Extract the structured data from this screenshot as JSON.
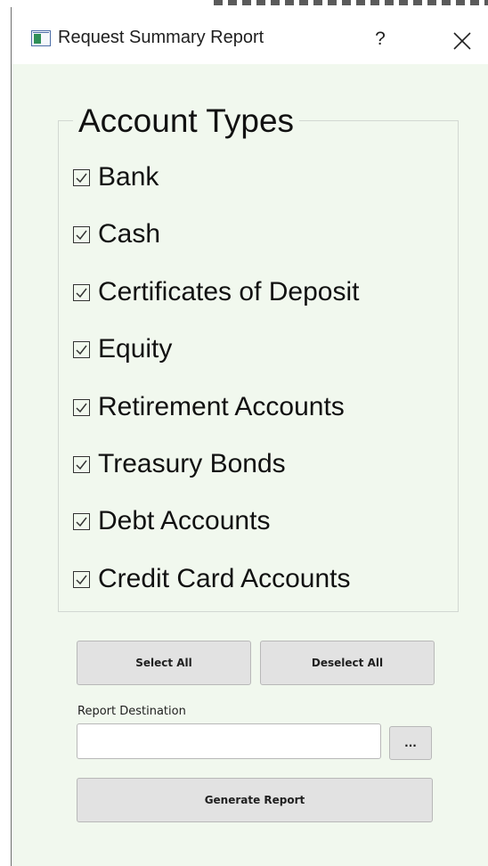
{
  "window": {
    "title": "Request Summary Report",
    "help_label": "?",
    "icon": "app-window-icon",
    "close_icon": "close-icon"
  },
  "account_types": {
    "title": "Account Types",
    "items": [
      {
        "label": "Bank",
        "checked": true
      },
      {
        "label": "Cash",
        "checked": true
      },
      {
        "label": "Certificates of Deposit",
        "checked": true
      },
      {
        "label": "Equity",
        "checked": true
      },
      {
        "label": "Retirement Accounts",
        "checked": true
      },
      {
        "label": "Treasury Bonds",
        "checked": true
      },
      {
        "label": "Debt Accounts",
        "checked": true
      },
      {
        "label": "Credit Card Accounts",
        "checked": true
      }
    ]
  },
  "actions": {
    "select_all": "Select All",
    "deselect_all": "Deselect All",
    "browse": "...",
    "generate": "Generate Report"
  },
  "report_destination": {
    "label": "Report Destination",
    "value": "",
    "placeholder": ""
  },
  "colors": {
    "background": "#f1f8ee",
    "button": "#e2e2e2",
    "button_border": "#b8b8b8",
    "text": "#111111"
  }
}
